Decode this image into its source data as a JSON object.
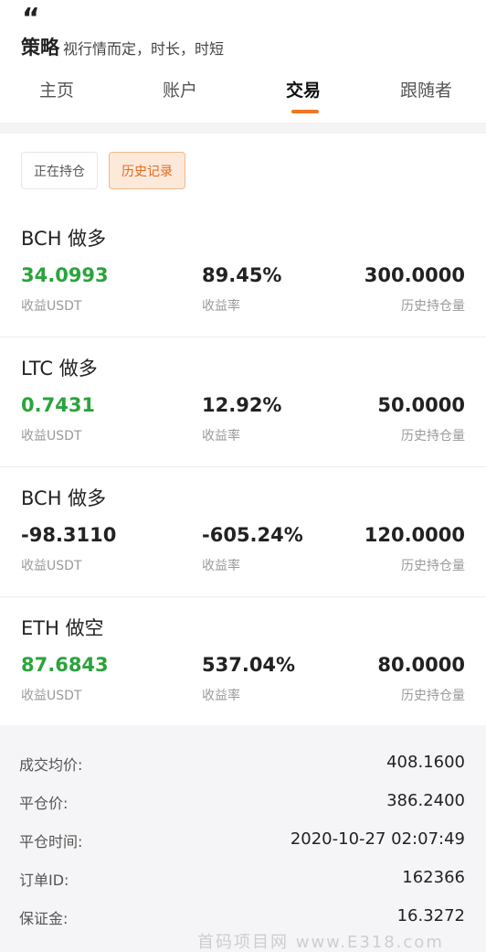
{
  "header": {
    "quote_mark": "“",
    "strategy_title": "策略",
    "strategy_desc": "视行情而定，时长，时短"
  },
  "tabs": [
    {
      "label": "主页"
    },
    {
      "label": "账户"
    },
    {
      "label": "交易",
      "active": true
    },
    {
      "label": "跟随者"
    }
  ],
  "filters": {
    "holding": "正在持仓",
    "history": "历史记录",
    "active": "history"
  },
  "labels": {
    "profit": "收益USDT",
    "rate": "收益率",
    "qty": "历史持仓量"
  },
  "trades": [
    {
      "name": "BCH 做多",
      "profit": "34.0993",
      "rate": "89.45%",
      "qty": "300.0000",
      "profit_color": "#2aa43c"
    },
    {
      "name": "LTC 做多",
      "profit": "0.7431",
      "rate": "12.92%",
      "qty": "50.0000",
      "profit_color": "#2aa43c"
    },
    {
      "name": "BCH 做多",
      "profit": "-98.3110",
      "rate": "-605.24%",
      "qty": "120.0000",
      "profit_color": "#222222"
    },
    {
      "name": "ETH 做空",
      "profit": "87.6843",
      "rate": "537.04%",
      "qty": "80.0000",
      "profit_color": "#2aa43c"
    }
  ],
  "details": [
    {
      "key": "成交均价:",
      "value": "408.1600"
    },
    {
      "key": "平仓价:",
      "value": "386.2400"
    },
    {
      "key": "平仓时间:",
      "value": "2020-10-27 02:07:49"
    },
    {
      "key": "订单ID:",
      "value": "162366"
    },
    {
      "key": "保证金:",
      "value": "16.3272"
    }
  ],
  "watermark": "首码项目网 www.E318.com",
  "colors": {
    "accent": "#f07621",
    "positive": "#2aa43c"
  }
}
